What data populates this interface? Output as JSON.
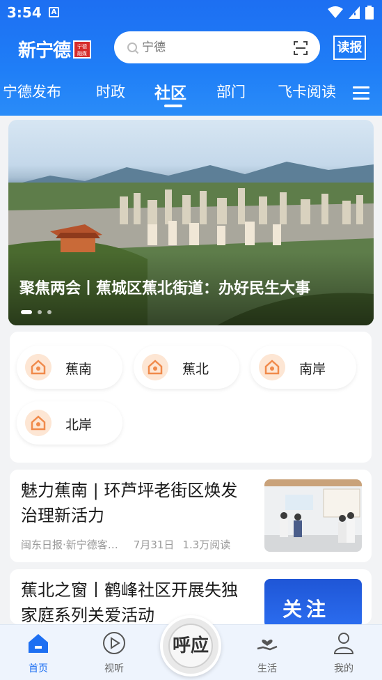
{
  "status_bar": {
    "time": "3:54",
    "notif_icon": "A"
  },
  "header": {
    "logo_text": "新宁德",
    "logo_seal": "宁德\n融媒",
    "search_placeholder": "宁德",
    "read_paper_label": "读报",
    "tabs": [
      {
        "label": "宁德发布",
        "active": false
      },
      {
        "label": "时政",
        "active": false
      },
      {
        "label": "社区",
        "active": true
      },
      {
        "label": "部门",
        "active": false
      },
      {
        "label": "飞卡阅读",
        "active": false
      }
    ]
  },
  "banner": {
    "caption": "聚焦两会丨蕉城区蕉北街道：办好民生大事",
    "slide_count": 3,
    "active_slide": 1
  },
  "districts": [
    {
      "label": "蕉南"
    },
    {
      "label": "蕉北"
    },
    {
      "label": "南岸"
    },
    {
      "label": "北岸"
    }
  ],
  "news": [
    {
      "title": "魅力蕉南 | 环芦坪老街区焕发治理新活力",
      "source": "闽东日报·新宁德客…",
      "date": "7月31日",
      "views": "1.3万阅读"
    },
    {
      "title": "蕉北之窗丨鹤峰社区开展失独家庭系列关爱活动",
      "thumb_text": "关注"
    }
  ],
  "bottom_nav": {
    "items": [
      {
        "label": "首页",
        "active": true
      },
      {
        "label": "视听",
        "active": false
      },
      {
        "label": "生活",
        "active": false
      },
      {
        "label": "我的",
        "active": false
      }
    ],
    "center_label": "呼应"
  },
  "colors": {
    "brand_blue": "#1d6ff2",
    "icon_orange": "#f08a4b"
  }
}
